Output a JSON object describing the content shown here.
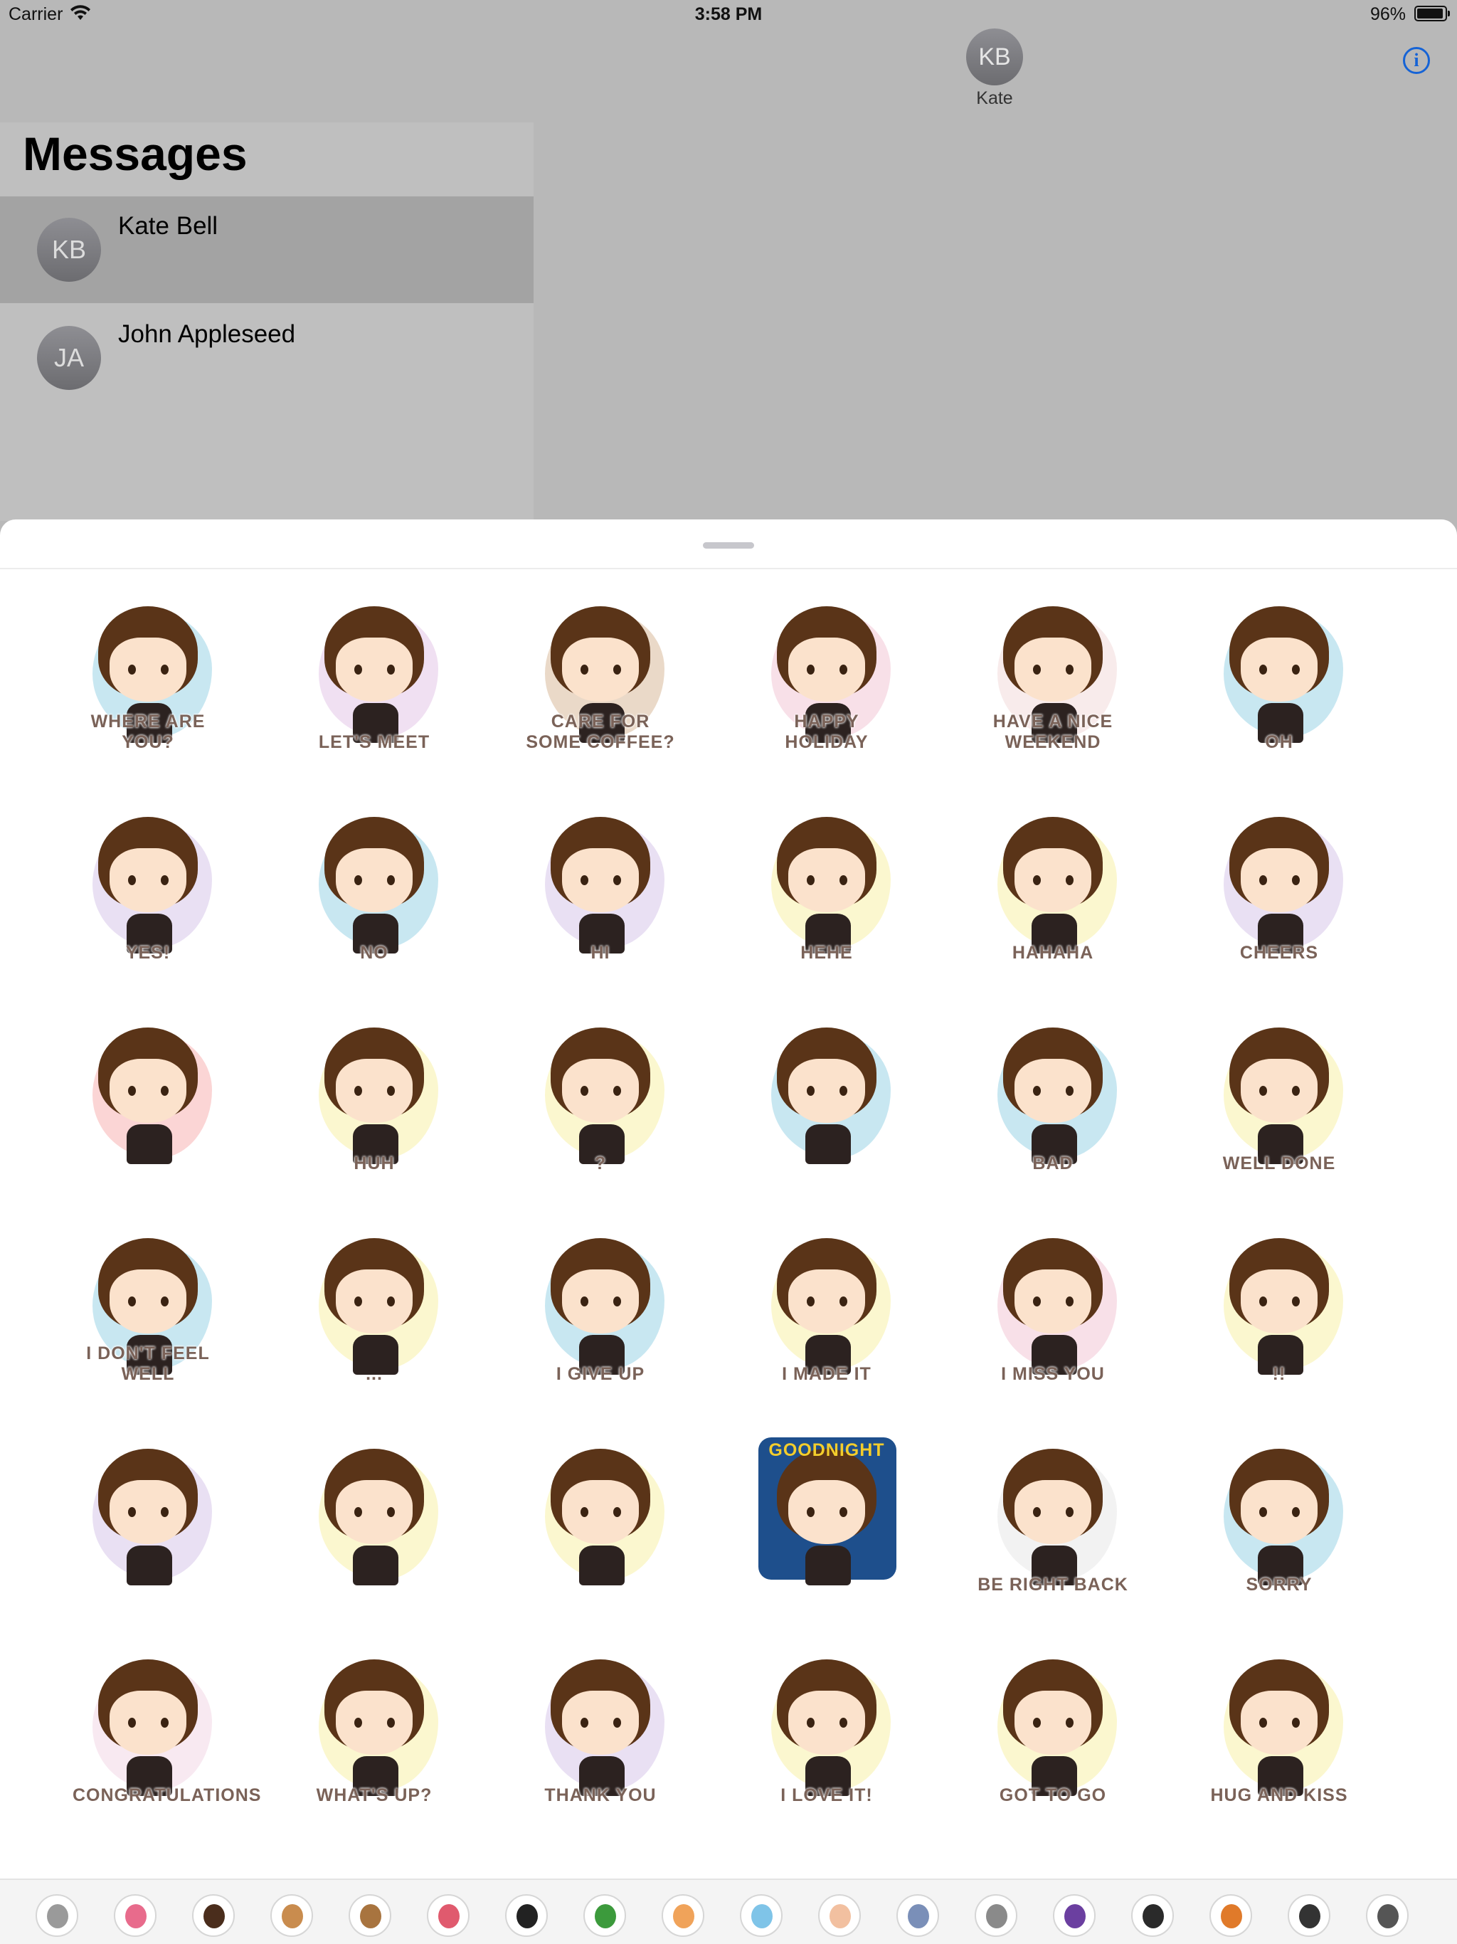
{
  "status_bar": {
    "carrier": "Carrier",
    "time": "3:58 PM",
    "battery": "96%"
  },
  "header": {
    "contact_initials": "KB",
    "contact_name": "Kate",
    "info_label": "i"
  },
  "messages": {
    "title": "Messages",
    "conversations": [
      {
        "initials": "KB",
        "name": "Kate Bell",
        "selected": true
      },
      {
        "initials": "JA",
        "name": "John Appleseed",
        "selected": false
      }
    ]
  },
  "stickers": [
    {
      "caption": "WHERE ARE YOU?",
      "color": "#9ad3e6"
    },
    {
      "caption": "LET'S MEET",
      "color": "#e3c7e8"
    },
    {
      "caption": "CARE FOR SOME COFFEE?",
      "color": "#d9b99a"
    },
    {
      "caption": "HAPPY HOLIDAY",
      "color": "#f3c7d6"
    },
    {
      "caption": "HAVE A NICE WEEKEND",
      "color": "#f2dada"
    },
    {
      "caption": "OH",
      "color": "#9ad3e6"
    },
    {
      "caption": "YES!",
      "color": "#d7c6ea"
    },
    {
      "caption": "NO",
      "color": "#9ad3e6"
    },
    {
      "caption": "HI",
      "color": "#d7c6ea"
    },
    {
      "caption": "HEHE",
      "color": "#f7f0a8"
    },
    {
      "caption": "HAHAHA",
      "color": "#f7f0a8"
    },
    {
      "caption": "CHEERS",
      "color": "#d7c6ea"
    },
    {
      "caption": "",
      "color": "#f7b3b3"
    },
    {
      "caption": "HUH",
      "color": "#f7f0a8"
    },
    {
      "caption": "?",
      "color": "#f7f0a8"
    },
    {
      "caption": "",
      "color": "#9ad3e6"
    },
    {
      "caption": "BAD",
      "color": "#9ad3e6"
    },
    {
      "caption": "WELL DONE",
      "color": "#f7f0a8"
    },
    {
      "caption": "I DON'T FEEL WELL",
      "color": "#9ad3e6"
    },
    {
      "caption": "...",
      "color": "#f7f0a8"
    },
    {
      "caption": "I GIVE UP",
      "color": "#9ad3e6"
    },
    {
      "caption": "I MADE IT",
      "color": "#f7f0a8"
    },
    {
      "caption": "I MISS YOU",
      "color": "#f3c7d6"
    },
    {
      "caption": "!!",
      "color": "#f7f0a8"
    },
    {
      "caption": "",
      "color": "#d7c6ea"
    },
    {
      "caption": "",
      "color": "#f7f0a8"
    },
    {
      "caption": "",
      "color": "#f7f0a8"
    },
    {
      "caption": "GOODNIGHT",
      "color": "#1e4f8c",
      "dark": true
    },
    {
      "caption": "BE RIGHT BACK",
      "color": "#e8e8e8"
    },
    {
      "caption": "SORRY",
      "color": "#9ad3e6"
    },
    {
      "caption": "CONGRATULATIONS",
      "color": "#f3d7e6"
    },
    {
      "caption": "WHAT'S UP?",
      "color": "#f7f0a8"
    },
    {
      "caption": "THANK YOU",
      "color": "#d7c6ea"
    },
    {
      "caption": "I LOVE IT!",
      "color": "#f7f0a8"
    },
    {
      "caption": "GOT TO GO",
      "color": "#f7f0a8"
    },
    {
      "caption": "HUG AND KISS",
      "color": "#f7f0a8"
    }
  ],
  "app_strip": {
    "icons": [
      {
        "name": "app-icon-1",
        "color": "#9a9a9a"
      },
      {
        "name": "app-icon-2",
        "color": "#e86b8c"
      },
      {
        "name": "app-icon-3",
        "color": "#4a2d1c"
      },
      {
        "name": "app-icon-4",
        "color": "#c98c4e"
      },
      {
        "name": "app-icon-5",
        "color": "#a8743f"
      },
      {
        "name": "app-icon-6",
        "color": "#e05a6e"
      },
      {
        "name": "app-icon-7",
        "color": "#222222"
      },
      {
        "name": "app-icon-8",
        "color": "#3c9a3c"
      },
      {
        "name": "app-icon-9",
        "color": "#f0a35a"
      },
      {
        "name": "app-icon-10",
        "color": "#7fc4e8"
      },
      {
        "name": "app-icon-11",
        "color": "#f2c0a0"
      },
      {
        "name": "app-icon-12",
        "color": "#7a8fb8"
      },
      {
        "name": "app-icon-13",
        "color": "#8a8a8a"
      },
      {
        "name": "app-icon-14",
        "color": "#6b3fa0"
      },
      {
        "name": "app-icon-15",
        "color": "#2a2a2a"
      },
      {
        "name": "app-icon-16",
        "color": "#e07a2a"
      },
      {
        "name": "app-icon-17",
        "color": "#333333"
      },
      {
        "name": "app-icon-18",
        "color": "#555555"
      }
    ]
  }
}
